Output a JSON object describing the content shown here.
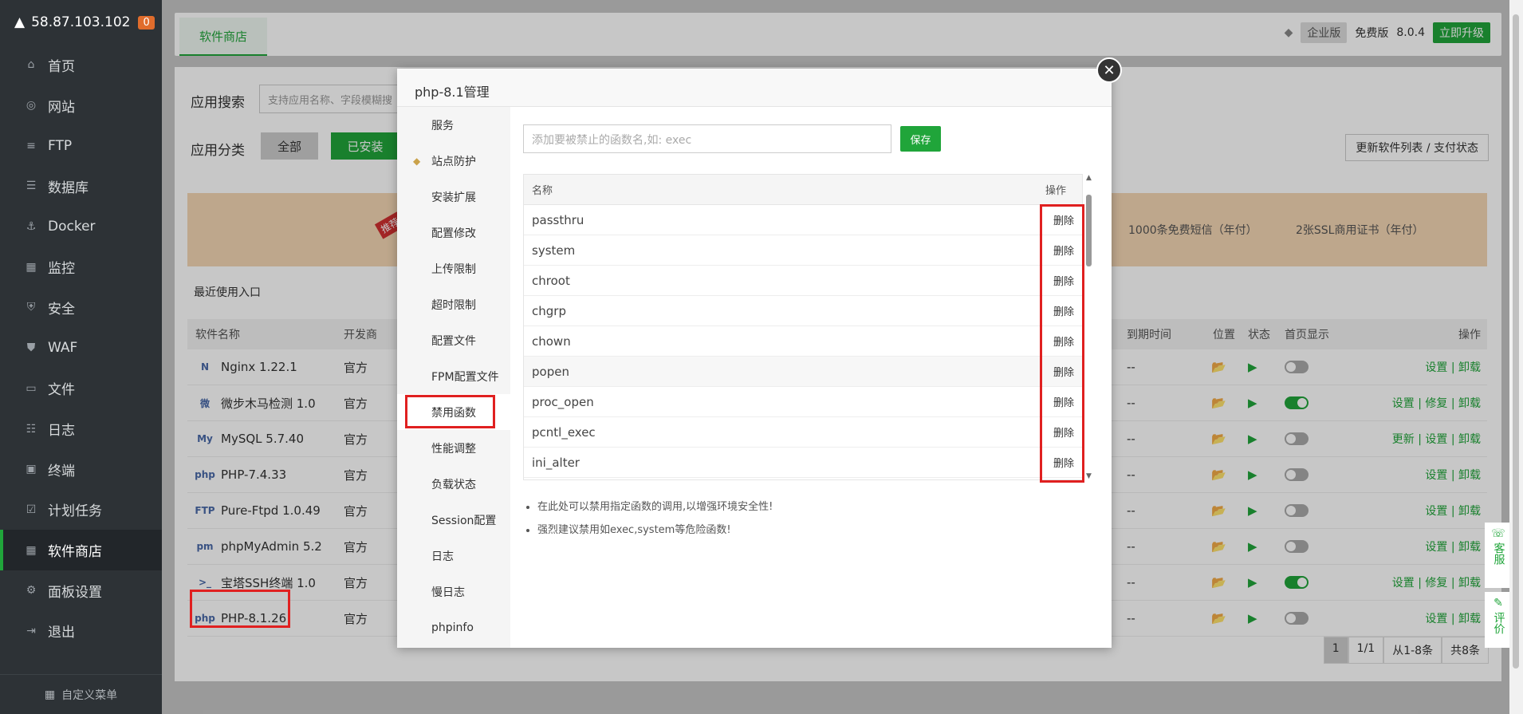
{
  "sidebar": {
    "ip": "58.87.103.102",
    "badge": "0",
    "items": [
      "首页",
      "网站",
      "FTP",
      "数据库",
      "Docker",
      "监控",
      "安全",
      "WAF",
      "文件",
      "日志",
      "终端",
      "计划任务",
      "软件商店",
      "面板设置",
      "退出"
    ],
    "active_index": 12,
    "bottom": "自定义菜单"
  },
  "topbar": {
    "tab": "软件商店",
    "edition": "企业版",
    "free": "免费版",
    "version": "8.0.4",
    "upgrade": "立即升级"
  },
  "search": {
    "label": "应用搜索",
    "placeholder": "支持应用名称、字段模糊搜"
  },
  "category": {
    "label": "应用分类",
    "all": "全部",
    "installed": "已安装",
    "refresh": "更新软件列表 / 支付状态"
  },
  "banner": {
    "tag": "推荐",
    "sms": "1000条免费短信（年付）",
    "ssl": "2张SSL商用证书（年付）"
  },
  "recent": "最近使用入口",
  "table": {
    "headers": [
      "软件名称",
      "开发商",
      "到期时间",
      "位置",
      "状态",
      "首页显示",
      "操作"
    ],
    "rows": [
      {
        "name": "Nginx 1.22.1",
        "icon": "N",
        "dev": "官方",
        "exp": "--",
        "on": false,
        "ops": "设置 | 卸载"
      },
      {
        "name": "微步木马检测 1.0",
        "icon": "微",
        "dev": "官方",
        "exp": "--",
        "on": true,
        "ops": "设置 | 修复 | 卸载"
      },
      {
        "name": "MySQL 5.7.40",
        "icon": "My",
        "dev": "官方",
        "exp": "--",
        "on": false,
        "ops": "更新 | 设置 | 卸载"
      },
      {
        "name": "PHP-7.4.33",
        "icon": "php",
        "dev": "官方",
        "exp": "--",
        "on": false,
        "ops": "设置 | 卸载"
      },
      {
        "name": "Pure-Ftpd 1.0.49",
        "icon": "FTP",
        "dev": "官方",
        "exp": "--",
        "on": false,
        "ops": "设置 | 卸载"
      },
      {
        "name": "phpMyAdmin 5.2",
        "icon": "pm",
        "dev": "官方",
        "exp": "--",
        "on": false,
        "ops": "设置 | 卸载"
      },
      {
        "name": "宝塔SSH终端 1.0",
        "icon": ">_",
        "dev": "官方",
        "exp": "--",
        "on": true,
        "ops": "设置 | 修复 | 卸载"
      },
      {
        "name": "PHP-8.1.26",
        "icon": "php",
        "dev": "官方",
        "exp": "--",
        "on": false,
        "ops": "设置 | 卸载"
      }
    ]
  },
  "pager": {
    "page": "1",
    "pages": "1/1",
    "range": "从1-8条",
    "total": "共8条"
  },
  "modal": {
    "title": "php-8.1管理",
    "nav": [
      "服务",
      "站点防护",
      "安装扩展",
      "配置修改",
      "上传限制",
      "超时限制",
      "配置文件",
      "FPM配置文件",
      "禁用函数",
      "性能调整",
      "负载状态",
      "Session配置",
      "日志",
      "慢日志",
      "phpinfo"
    ],
    "active_index": 8,
    "input_placeholder": "添加要被禁止的函数名,如: exec",
    "save": "保存",
    "col_name": "名称",
    "col_op": "操作",
    "functions": [
      "passthru",
      "system",
      "chroot",
      "chgrp",
      "chown",
      "popen",
      "proc_open",
      "pcntl_exec",
      "ini_alter"
    ],
    "delete": "删除",
    "notes": [
      "在此处可以禁用指定函数的调用,以增强环境安全性!",
      "强烈建议禁用如exec,system等危险函数!"
    ]
  },
  "float": {
    "service": "客服",
    "review": "评价"
  }
}
